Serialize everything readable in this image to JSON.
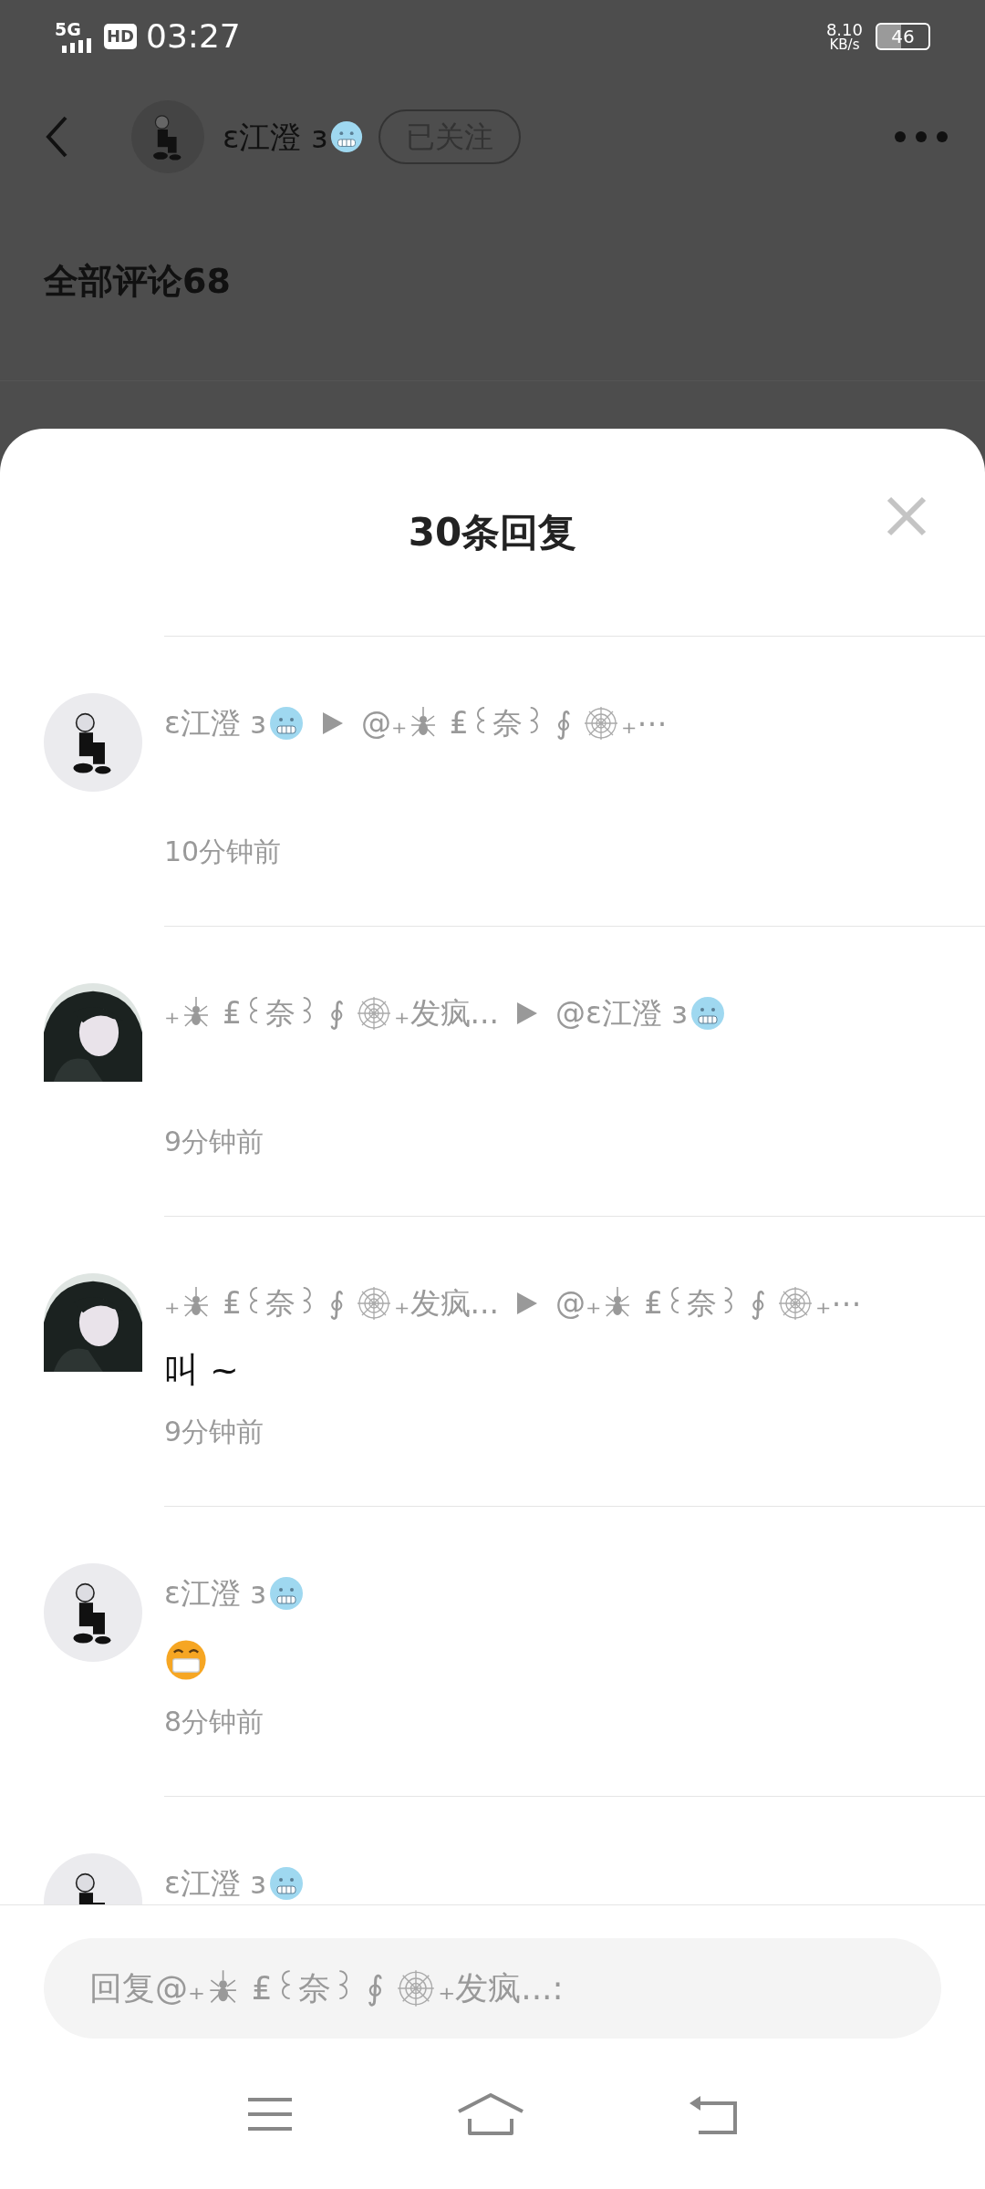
{
  "status_bar": {
    "network": "5G",
    "hd": "HD",
    "time": "03:27",
    "speed": "8.10",
    "speed_unit": "KB/s",
    "battery": "46"
  },
  "header": {
    "avatar": {
      "kind": "figure"
    },
    "name": [
      {
        "kind": "text",
        "text": "ɛ江澄 ɜ"
      },
      {
        "kind": "cold"
      }
    ],
    "follow": "已关注"
  },
  "comments_title": "全部评论68",
  "sheet": {
    "title": "30条回复",
    "replies": [
      {
        "avatar": {
          "kind": "figure"
        },
        "author": [
          {
            "kind": "text",
            "text": "ɛ江澄 ɜ"
          },
          {
            "kind": "cold"
          }
        ],
        "target": [
          {
            "kind": "text",
            "text": "@₊"
          },
          {
            "kind": "spider"
          },
          {
            "kind": "text",
            "text": " ₤꒰奈꒱ ∮ "
          },
          {
            "kind": "web"
          },
          {
            "kind": "text",
            "text": "₊⋯"
          }
        ],
        "time": "10分钟前"
      },
      {
        "avatar": {
          "kind": "dark"
        },
        "author": [
          {
            "kind": "text",
            "text": "₊"
          },
          {
            "kind": "spider"
          },
          {
            "kind": "text",
            "text": " ₤꒰奈꒱ ∮ "
          },
          {
            "kind": "web"
          },
          {
            "kind": "text",
            "text": "₊发疯..."
          }
        ],
        "target": [
          {
            "kind": "text",
            "text": "@ɛ江澄 ɜ"
          },
          {
            "kind": "cold"
          }
        ],
        "time": "9分钟前"
      },
      {
        "avatar": {
          "kind": "dark"
        },
        "author": [
          {
            "kind": "text",
            "text": "₊"
          },
          {
            "kind": "spider"
          },
          {
            "kind": "text",
            "text": " ₤꒰奈꒱ ∮ "
          },
          {
            "kind": "web"
          },
          {
            "kind": "text",
            "text": "₊发疯..."
          }
        ],
        "target": [
          {
            "kind": "text",
            "text": "@₊"
          },
          {
            "kind": "spider"
          },
          {
            "kind": "text",
            "text": " ₤꒰奈꒱ ∮ "
          },
          {
            "kind": "web"
          },
          {
            "kind": "text",
            "text": "₊⋯"
          }
        ],
        "content": [
          {
            "kind": "text",
            "text": "叫 ~"
          }
        ],
        "time": "9分钟前"
      },
      {
        "avatar": {
          "kind": "figure"
        },
        "author": [
          {
            "kind": "text",
            "text": "ɛ江澄 ɜ"
          },
          {
            "kind": "cold"
          }
        ],
        "content": [
          {
            "kind": "mask"
          }
        ],
        "time": "8分钟前"
      },
      {
        "avatar": {
          "kind": "figure"
        },
        "author": [
          {
            "kind": "text",
            "text": "ɛ江澄 ɜ"
          },
          {
            "kind": "cold"
          }
        ]
      }
    ],
    "input": {
      "placeholder": [
        {
          "kind": "text",
          "text": "回复@₊"
        },
        {
          "kind": "spider"
        },
        {
          "kind": "text",
          "text": " ₤꒰奈꒱ ∮ "
        },
        {
          "kind": "web"
        },
        {
          "kind": "text",
          "text": "₊发疯...:"
        }
      ]
    }
  }
}
